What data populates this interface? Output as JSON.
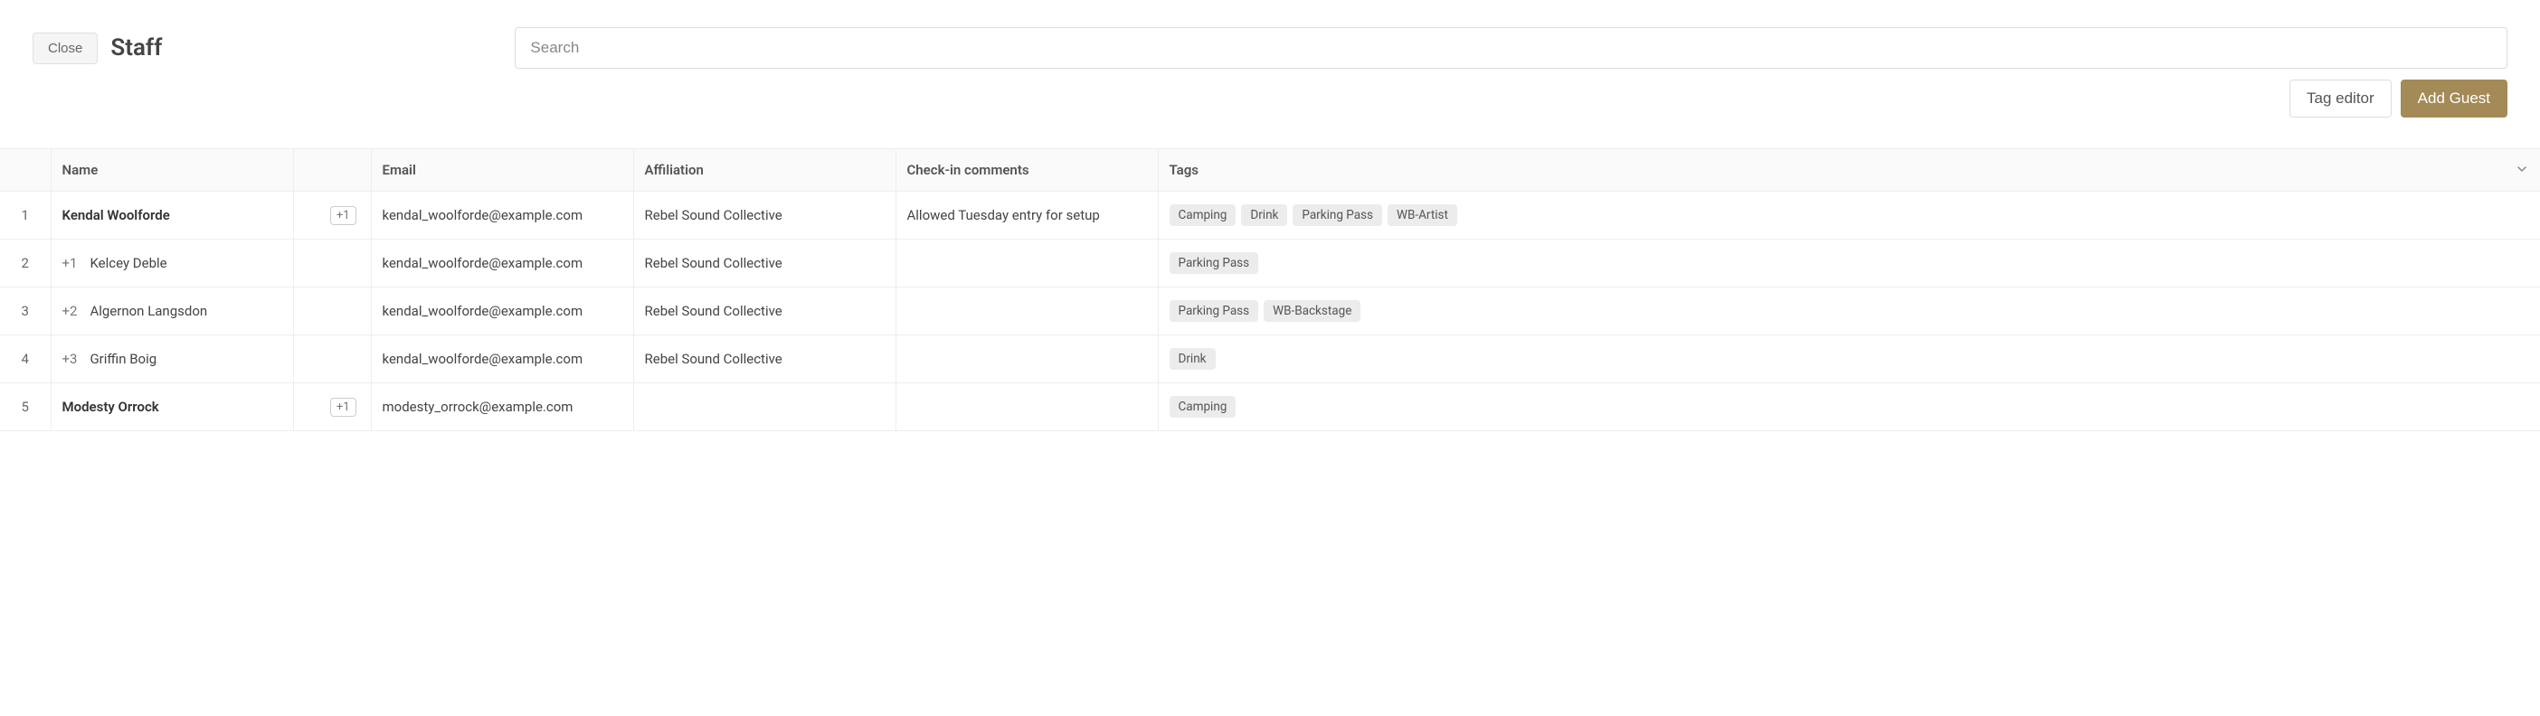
{
  "header": {
    "close_label": "Close",
    "title": "Staff",
    "search_placeholder": "Search"
  },
  "actions": {
    "tag_editor_label": "Tag editor",
    "add_guest_label": "Add Guest"
  },
  "columns": {
    "name": "Name",
    "email": "Email",
    "affiliation": "Affiliation",
    "comments": "Check-in comments",
    "tags": "Tags"
  },
  "rows": [
    {
      "num": "1",
      "is_primary": true,
      "plusone_prefix": "",
      "name": "Kendal Woolforde",
      "plus_badge": "+1",
      "email": "kendal_woolforde@example.com",
      "email_muted": false,
      "affiliation": "Rebel Sound Collective",
      "affiliation_muted": false,
      "comments": "Allowed Tuesday entry for setup",
      "tags": [
        "Camping",
        "Drink",
        "Parking Pass",
        "WB-Artist"
      ]
    },
    {
      "num": "2",
      "is_primary": false,
      "plusone_prefix": "+1",
      "name": "Kelcey Deble",
      "plus_badge": "",
      "email": "kendal_woolforde@example.com",
      "email_muted": true,
      "affiliation": "Rebel Sound Collective",
      "affiliation_muted": true,
      "comments": "",
      "tags": [
        "Parking Pass"
      ]
    },
    {
      "num": "3",
      "is_primary": false,
      "plusone_prefix": "+2",
      "name": "Algernon Langsdon",
      "plus_badge": "",
      "email": "kendal_woolforde@example.com",
      "email_muted": true,
      "affiliation": "Rebel Sound Collective",
      "affiliation_muted": true,
      "comments": "",
      "tags": [
        "Parking Pass",
        "WB-Backstage"
      ]
    },
    {
      "num": "4",
      "is_primary": false,
      "plusone_prefix": "+3",
      "name": "Griffin Boig",
      "plus_badge": "",
      "email": "kendal_woolforde@example.com",
      "email_muted": true,
      "affiliation": "Rebel Sound Collective",
      "affiliation_muted": true,
      "comments": "",
      "tags": [
        "Drink"
      ]
    },
    {
      "num": "5",
      "is_primary": true,
      "plusone_prefix": "",
      "name": "Modesty Orrock",
      "plus_badge": "+1",
      "email": "modesty_orrock@example.com",
      "email_muted": false,
      "affiliation": "",
      "affiliation_muted": false,
      "comments": "",
      "tags": [
        "Camping"
      ]
    }
  ]
}
